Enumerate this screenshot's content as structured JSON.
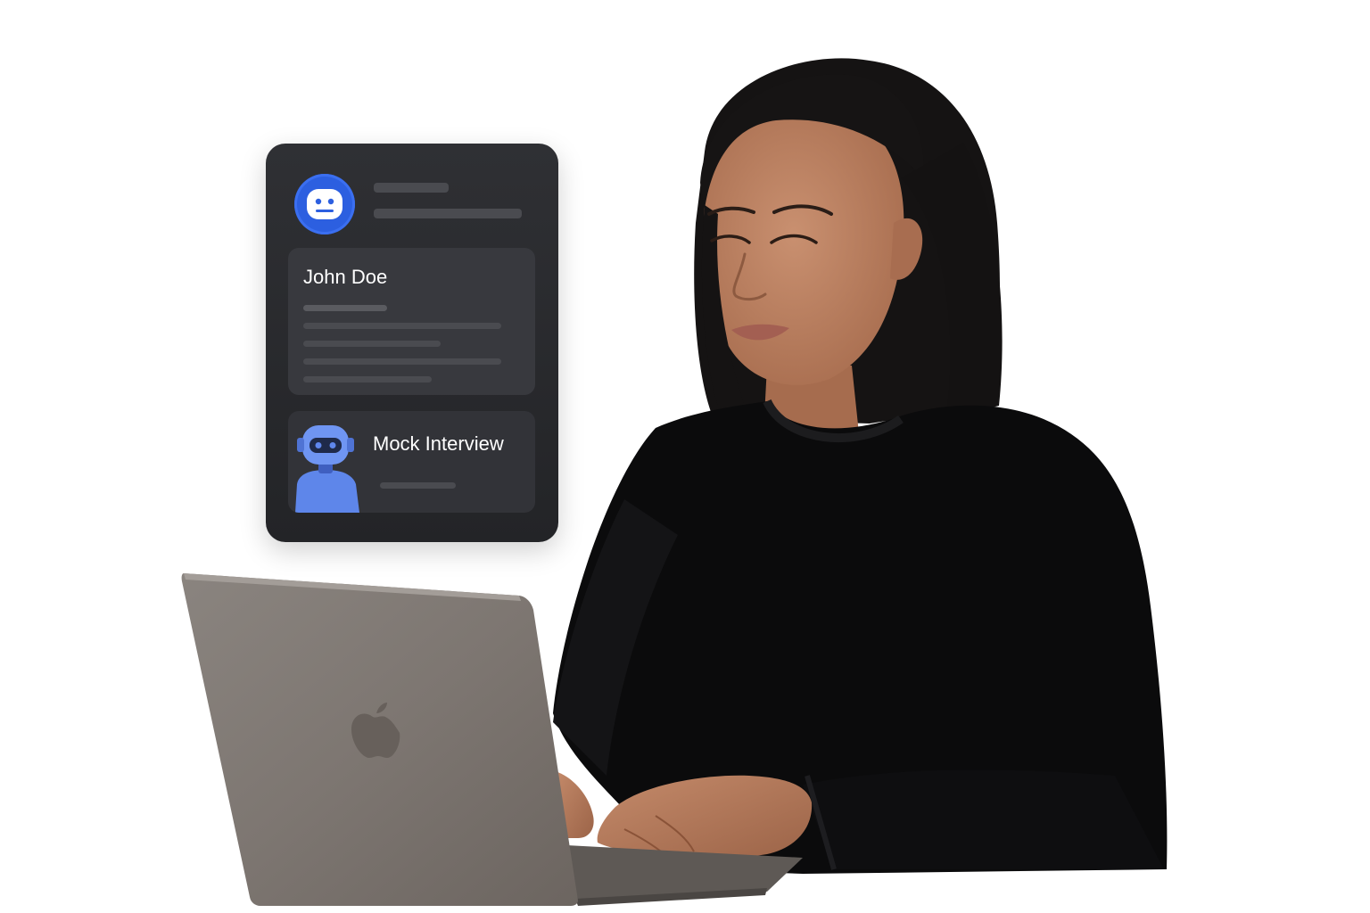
{
  "card": {
    "profile_name": "John Doe",
    "interview_label": "Mock Interview",
    "avatar_icon": "robot-face-icon",
    "interviewer_icon": "robot-interviewer-icon",
    "accent_color": "#2c5fe0"
  },
  "scene": {
    "laptop_logo_icon": "apple-logo-icon"
  }
}
